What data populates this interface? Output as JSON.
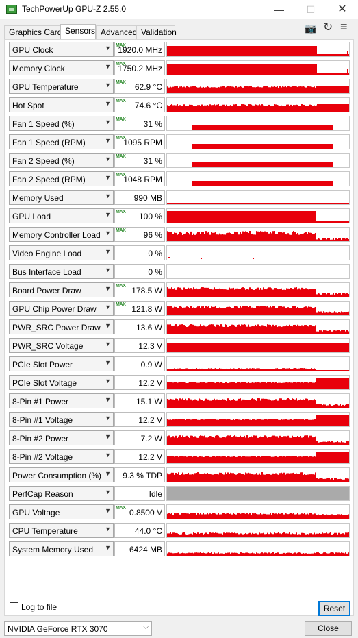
{
  "window": {
    "title": "TechPowerUp GPU-Z 2.55.0",
    "min_glyph": "—",
    "max_glyph": "☐",
    "close_glyph": "✕"
  },
  "tabs": [
    {
      "label": "Graphics Card",
      "active": false
    },
    {
      "label": "Sensors",
      "active": true
    },
    {
      "label": "Advanced",
      "active": false
    },
    {
      "label": "Validation",
      "active": false
    }
  ],
  "toolbar": {
    "camera_icon": "camera-icon",
    "refresh_icon": "refresh-icon",
    "menu_icon": "menu-icon",
    "camera_glyph": "📷",
    "refresh_glyph": "↻",
    "menu_glyph": "≡"
  },
  "colors": {
    "graph_red": "#e8000b",
    "graph_gray": "#aaaaaa",
    "max_green": "#2a8a2a",
    "reset_border": "#0078d7"
  },
  "sensors": [
    {
      "name": "GPU Clock",
      "value": "1920.0 MHz",
      "max": true,
      "graph": "clock"
    },
    {
      "name": "Memory Clock",
      "value": "1750.2 MHz",
      "max": true,
      "graph": "clock"
    },
    {
      "name": "GPU Temperature",
      "value": "62.9 °C",
      "max": true,
      "graph": "temp"
    },
    {
      "name": "Hot Spot",
      "value": "74.6 °C",
      "max": true,
      "graph": "temp"
    },
    {
      "name": "Fan 1 Speed (%)",
      "value": "31 %",
      "max": true,
      "graph": "fan"
    },
    {
      "name": "Fan 1 Speed (RPM)",
      "value": "1095 RPM",
      "max": true,
      "graph": "fan"
    },
    {
      "name": "Fan 2 Speed (%)",
      "value": "31 %",
      "max": true,
      "graph": "fan"
    },
    {
      "name": "Fan 2 Speed (RPM)",
      "value": "1048 RPM",
      "max": true,
      "graph": "fan"
    },
    {
      "name": "Memory Used",
      "value": "990 MB",
      "max": false,
      "graph": "flat"
    },
    {
      "name": "GPU Load",
      "value": "100 %",
      "max": true,
      "graph": "load"
    },
    {
      "name": "Memory Controller Load",
      "value": "96 %",
      "max": true,
      "graph": "noisy"
    },
    {
      "name": "Video Engine Load",
      "value": "0 %",
      "max": false,
      "graph": "dots"
    },
    {
      "name": "Bus Interface Load",
      "value": "0 %",
      "max": false,
      "graph": "none"
    },
    {
      "name": "Board Power Draw",
      "value": "178.5 W",
      "max": true,
      "graph": "power"
    },
    {
      "name": "GPU Chip Power Draw",
      "value": "121.8 W",
      "max": true,
      "graph": "power"
    },
    {
      "name": "PWR_SRC Power Draw",
      "value": "13.6 W",
      "max": false,
      "graph": "power"
    },
    {
      "name": "PWR_SRC Voltage",
      "value": "12.3 V",
      "max": false,
      "graph": "full"
    },
    {
      "name": "PCIe Slot Power",
      "value": "0.9 W",
      "max": false,
      "graph": "low"
    },
    {
      "name": "PCIe Slot Voltage",
      "value": "12.2 V",
      "max": false,
      "graph": "volt"
    },
    {
      "name": "8-Pin #1 Power",
      "value": "15.1 W",
      "max": false,
      "graph": "power"
    },
    {
      "name": "8-Pin #1 Voltage",
      "value": "12.2 V",
      "max": false,
      "graph": "volt"
    },
    {
      "name": "8-Pin #2 Power",
      "value": "7.2 W",
      "max": false,
      "graph": "power"
    },
    {
      "name": "8-Pin #2 Voltage",
      "value": "12.2 V",
      "max": false,
      "graph": "volt"
    },
    {
      "name": "Power Consumption (%)",
      "value": "9.3 % TDP",
      "max": false,
      "graph": "power"
    },
    {
      "name": "PerfCap Reason",
      "value": "Idle",
      "max": false,
      "graph": "gray"
    },
    {
      "name": "GPU Voltage",
      "value": "0.8500 V",
      "max": true,
      "graph": "gpuvolt"
    },
    {
      "name": "CPU Temperature",
      "value": "44.0 °C",
      "max": false,
      "graph": "cputemp"
    },
    {
      "name": "System Memory Used",
      "value": "6424 MB",
      "max": false,
      "graph": "sysmem"
    }
  ],
  "max_label": "MAX",
  "log_to_file": {
    "label": "Log to file",
    "checked": false
  },
  "reset_label": "Reset",
  "close_label": "Close",
  "gpu_select": {
    "value": "NVIDIA GeForce RTX 3070"
  }
}
